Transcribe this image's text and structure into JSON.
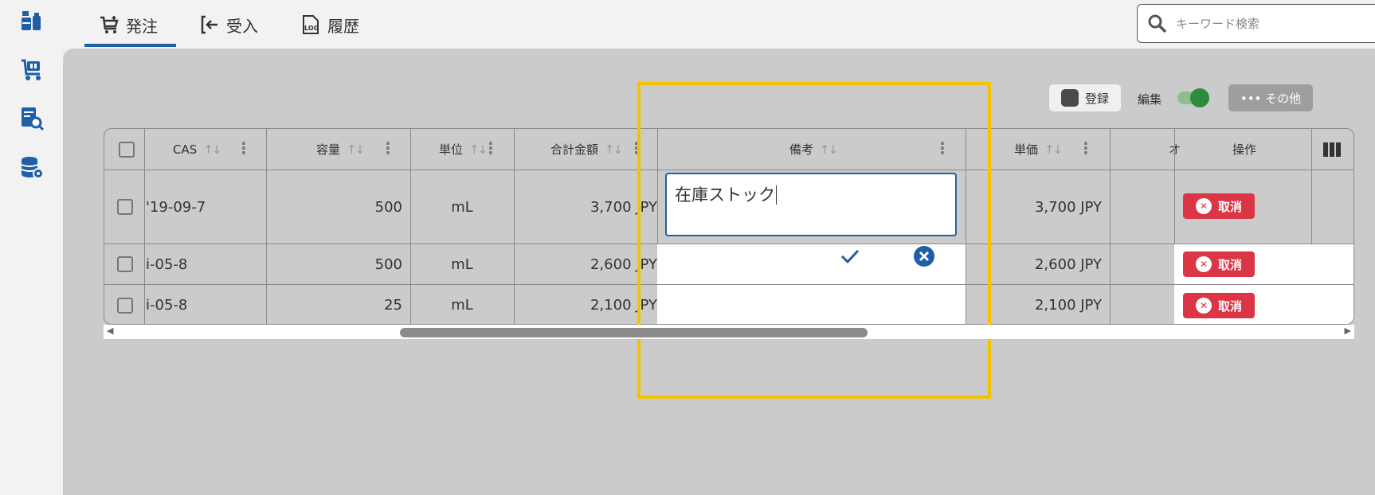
{
  "sidebar": {
    "icons": [
      "chemicals-icon",
      "cart-icon",
      "document-search-icon",
      "database-settings-icon"
    ]
  },
  "tabs": [
    {
      "label": "発注",
      "icon": "cart-icon",
      "active": true
    },
    {
      "label": "受入",
      "icon": "sign-in-icon",
      "active": false
    },
    {
      "label": "履歴",
      "icon": "log-icon",
      "active": false
    }
  ],
  "search": {
    "placeholder": "キーワード検索"
  },
  "toolbar": {
    "register_label": "登録",
    "edit_label": "編集",
    "edit_enabled": true,
    "other_label": "••• その他"
  },
  "table": {
    "columns": {
      "cas": "CAS",
      "volume": "容量",
      "unit": "単位",
      "total": "合計金額",
      "remarks": "備考",
      "unit_price": "単価",
      "hidden": "オ",
      "actions": "操作"
    },
    "rows": [
      {
        "cas": "'19-09-7",
        "volume": "500",
        "unit": "mL",
        "total": "3,700 JPY",
        "remarks": "",
        "unit_price": "3,700 JPY",
        "action": "取消"
      },
      {
        "cas": "i-05-8",
        "volume": "500",
        "unit": "mL",
        "total": "2,600 JPY",
        "remarks": "",
        "unit_price": "2,600 JPY",
        "action": "取消"
      },
      {
        "cas": "i-05-8",
        "volume": "25",
        "unit": "mL",
        "total": "2,100 JPY",
        "remarks": "",
        "unit_price": "2,100 JPY",
        "action": "取消"
      }
    ],
    "editor_value": "在庫ストック"
  },
  "colors": {
    "accent": "#1f5fa8",
    "danger": "#dc3545",
    "highlight": "#f5c200",
    "toggle": "#2e8b3e"
  }
}
